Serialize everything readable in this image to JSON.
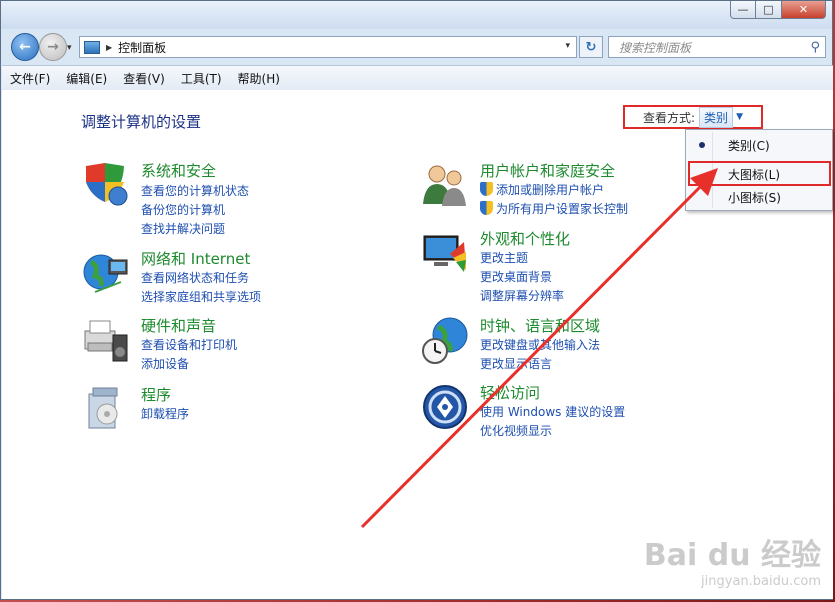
{
  "window": {
    "buttons": {
      "minimize": "—",
      "maximize": "□",
      "close": "✕"
    }
  },
  "nav": {
    "back_glyph": "←",
    "forward_glyph": "→",
    "history_glyph": "▾",
    "breadcrumb_sep": "▶",
    "address": "控制面板",
    "address_drop": "▾",
    "refresh_glyph": "↻",
    "search_placeholder": "搜索控制面板",
    "search_glyph": "⚲"
  },
  "menubar": [
    "文件(F)",
    "编辑(E)",
    "查看(V)",
    "工具(T)",
    "帮助(H)"
  ],
  "page": {
    "title": "调整计算机的设置",
    "view_by_label": "查看方式:",
    "view_by_value": "类别",
    "view_by_arrow": "▼"
  },
  "categories_left": [
    {
      "title": "系统和安全",
      "icon": "shield-pc-icon",
      "links": [
        "查看您的计算机状态",
        "备份您的计算机",
        "查找并解决问题"
      ]
    },
    {
      "title": "网络和 Internet",
      "icon": "network-globe-icon",
      "links": [
        "查看网络状态和任务",
        "选择家庭组和共享选项"
      ]
    },
    {
      "title": "硬件和声音",
      "icon": "printer-speaker-icon",
      "links": [
        "查看设备和打印机",
        "添加设备"
      ]
    },
    {
      "title": "程序",
      "icon": "programs-box-icon",
      "links": [
        "卸载程序"
      ]
    }
  ],
  "categories_right": [
    {
      "title": "用户帐户和家庭安全",
      "icon": "users-icon",
      "links": [
        "添加或删除用户帐户",
        "为所有用户设置家长控制"
      ],
      "shield_links": [
        true,
        true
      ]
    },
    {
      "title": "外观和个性化",
      "icon": "display-palette-icon",
      "links": [
        "更改主题",
        "更改桌面背景",
        "调整屏幕分辨率"
      ]
    },
    {
      "title": "时钟、语言和区域",
      "icon": "clock-globe-icon",
      "links": [
        "更改键盘或其他输入法",
        "更改显示语言"
      ]
    },
    {
      "title": "轻松访问",
      "icon": "ease-of-access-icon",
      "links": [
        "使用 Windows 建议的设置",
        "优化视频显示"
      ]
    }
  ],
  "dropdown": {
    "items": [
      "类别(C)",
      "大图标(L)",
      "小图标(S)"
    ],
    "selected": "类别(C)",
    "highlighted": "大图标(L)"
  },
  "watermark": {
    "logo": "Bai du 经验",
    "sub": "jingyan.baidu.com"
  },
  "colors": {
    "accent_red": "#e02a2a",
    "link_blue": "#1e4fb0",
    "category_green": "#1d8a2e",
    "title_navy": "#1e3287"
  }
}
